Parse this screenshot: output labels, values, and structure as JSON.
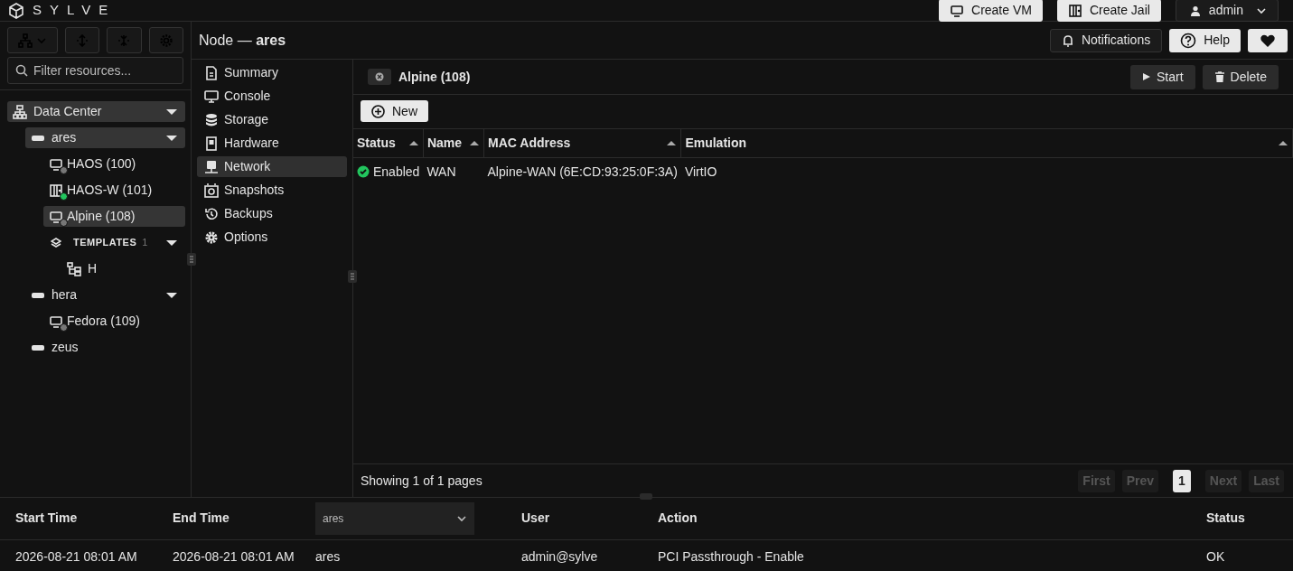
{
  "brand": "SYLVE",
  "top_actions": [
    {
      "label": "Create VM",
      "kind": "vm"
    },
    {
      "label": "Create Jail",
      "kind": "jail"
    }
  ],
  "user_menu": {
    "label": "admin"
  },
  "sidebar": {
    "filter": {
      "placeholder": "Filter resources..."
    },
    "tree": [
      {
        "label": "Data Center",
        "kind": "datacenter",
        "selected": true,
        "expanded": true,
        "children": [
          {
            "label": "ares",
            "kind": "node",
            "selected": true,
            "expanded": true,
            "children": [
              {
                "label": "HAOS (100)",
                "kind": "vm",
                "running": false,
                "selected": false
              },
              {
                "label": "HAOS-W (101)",
                "kind": "jail",
                "running": true,
                "selected": false
              },
              {
                "label": "Alpine (108)",
                "kind": "vm",
                "running": false,
                "selected": true
              },
              {
                "label": "TEMPLATES",
                "kind": "templates",
                "count": "1",
                "expanded": true,
                "selected": false,
                "children": [
                  {
                    "label": "H",
                    "kind": "template",
                    "selected": false
                  }
                ]
              }
            ]
          },
          {
            "label": "hera",
            "kind": "node",
            "selected": false,
            "expanded": true,
            "children": [
              {
                "label": "Fedora (109)",
                "kind": "vm",
                "running": false,
                "selected": false
              }
            ]
          },
          {
            "label": "zeus",
            "kind": "node",
            "selected": false
          }
        ]
      }
    ]
  },
  "title": "Node — **ares**",
  "header_actions": [
    {
      "label": "Notifications",
      "kind": "bell"
    },
    {
      "label": "Help",
      "kind": "help"
    },
    {
      "kind": "heart"
    }
  ],
  "submenu": [
    {
      "label": "Summary",
      "kind": "summary",
      "selected": false
    },
    {
      "label": "Console",
      "kind": "console",
      "selected": false
    },
    {
      "label": "Storage",
      "kind": "storage",
      "selected": false
    },
    {
      "label": "Hardware",
      "kind": "hardware",
      "selected": false
    },
    {
      "label": "Network",
      "kind": "network",
      "selected": true
    },
    {
      "label": "Snapshots",
      "kind": "snapshots",
      "selected": false
    },
    {
      "label": "Backups",
      "kind": "backups",
      "selected": false
    },
    {
      "label": "Options",
      "kind": "options",
      "selected": false
    }
  ],
  "tab": {
    "label": "Alpine (108)"
  },
  "tab_actions": [
    {
      "label": "Start",
      "kind": "start"
    },
    {
      "label": "Delete",
      "kind": "delete"
    }
  ],
  "new_button": {
    "label": "New"
  },
  "table": {
    "columns": [
      "Status",
      "Name",
      "MAC Address",
      "Emulation"
    ],
    "rows": [
      {
        "status": "Enabled",
        "enabled": true,
        "name": "WAN",
        "mac": "Alpine-WAN (6E:CD:93:25:0F:3A)",
        "emulation": "VirtIO"
      }
    ]
  },
  "pagination": {
    "summary": "Showing 1 of 1 pages",
    "buttons": [
      {
        "label": "First",
        "disabled": true
      },
      {
        "label": "Prev",
        "disabled": true
      },
      {
        "label": "1",
        "kind": "page",
        "selected": true
      },
      {
        "label": "Next",
        "disabled": true
      },
      {
        "label": "Last",
        "disabled": true
      }
    ]
  },
  "log": {
    "columns": [
      {
        "label": "Start Time",
        "kind": "text"
      },
      {
        "label": "End Time",
        "kind": "text"
      },
      {
        "value": "ares",
        "kind": "select"
      },
      {
        "label": "User",
        "kind": "text"
      },
      {
        "label": "Action",
        "kind": "text"
      },
      {
        "label": "Status",
        "kind": "text"
      }
    ],
    "rows": [
      [
        "2026-08-21 08:01 AM",
        "2026-08-21 08:01 AM",
        "ares",
        "admin@sylve",
        "PCI Passthrough - Enable",
        "OK"
      ]
    ]
  }
}
